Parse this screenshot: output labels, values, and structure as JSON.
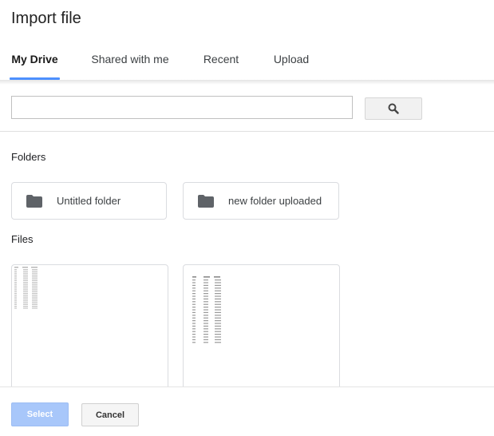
{
  "dialog": {
    "title": "Import file"
  },
  "tabs": [
    {
      "label": "My Drive",
      "active": true
    },
    {
      "label": "Shared with me",
      "active": false
    },
    {
      "label": "Recent",
      "active": false
    },
    {
      "label": "Upload",
      "active": false
    }
  ],
  "search": {
    "value": "",
    "placeholder": "",
    "button_icon": "search-icon"
  },
  "folders": {
    "heading": "Folders",
    "items": [
      {
        "name": "Untitled folder",
        "icon": "folder-icon"
      },
      {
        "name": "new folder uploaded",
        "icon": "folder-icon"
      }
    ]
  },
  "files": {
    "heading": "Files",
    "items": [
      {
        "thumbnail": "spreadsheet-thumbnail"
      },
      {
        "thumbnail": "spreadsheet-thumbnail"
      }
    ]
  },
  "footer": {
    "select_label": "Select",
    "cancel_label": "Cancel"
  },
  "colors": {
    "accent": "#4d90fe",
    "select_disabled": "#a8c7fa",
    "folder_icon": "#5f6368"
  }
}
